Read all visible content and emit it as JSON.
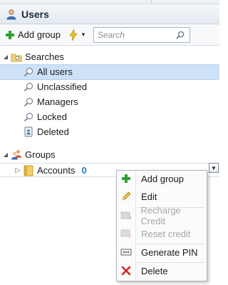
{
  "header": {
    "title": "Users",
    "icon": "user-icon"
  },
  "toolbar": {
    "add_group_label": "Add group",
    "search_placeholder": "Search"
  },
  "tree": {
    "searches": {
      "label": "Searches",
      "items": [
        {
          "label": "All users",
          "selected": true
        },
        {
          "label": "Unclassified"
        },
        {
          "label": "Managers"
        },
        {
          "label": "Locked"
        },
        {
          "label": "Deleted"
        }
      ]
    },
    "groups": {
      "label": "Groups",
      "items": [
        {
          "label": "Accounts",
          "count": "0"
        }
      ]
    }
  },
  "context_menu": {
    "items": [
      {
        "label": "Add group",
        "icon": "plus-icon",
        "enabled": true
      },
      {
        "label": "Edit",
        "icon": "pencil-icon",
        "enabled": true
      },
      {
        "label": "Recharge Credit",
        "icon": "recharge-icon",
        "enabled": false
      },
      {
        "label": "Reset credit",
        "icon": "reset-icon",
        "enabled": false
      },
      {
        "label": "Generate PIN",
        "icon": "pin-icon",
        "enabled": true
      },
      {
        "label": "Delete",
        "icon": "delete-x-icon",
        "enabled": true
      }
    ]
  },
  "colors": {
    "selection": "#cde1f7",
    "accent_count": "#1f7fc7",
    "add_green": "#2ea12e",
    "delete_red": "#d32a2a"
  }
}
